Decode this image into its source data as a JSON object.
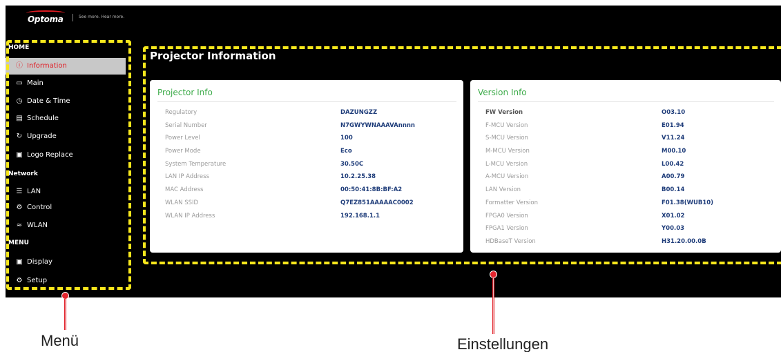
{
  "header": {
    "brand": "Optoma",
    "tagline": "See more. Hear more."
  },
  "sidebar": {
    "sections": [
      {
        "title": "HOME",
        "items": [
          {
            "icon": "info-circle-icon",
            "label": "Information",
            "active": true
          },
          {
            "icon": "monitor-icon",
            "label": "Main"
          },
          {
            "icon": "clock-icon",
            "label": "Date & Time"
          },
          {
            "icon": "calendar-icon",
            "label": "Schedule"
          },
          {
            "icon": "refresh-icon",
            "label": "Upgrade"
          },
          {
            "icon": "image-icon",
            "label": "Logo Replace"
          }
        ]
      },
      {
        "title": "Network",
        "items": [
          {
            "icon": "sitemap-icon",
            "label": "LAN"
          },
          {
            "icon": "cogs-icon",
            "label": "Control"
          },
          {
            "icon": "wifi-icon",
            "label": "WLAN"
          }
        ]
      },
      {
        "title": "MENU",
        "items": [
          {
            "icon": "image-icon",
            "label": "Display"
          },
          {
            "icon": "cogs-icon",
            "label": "Setup"
          }
        ]
      }
    ]
  },
  "main": {
    "title": "Projector Information",
    "projector_info": {
      "title": "Projector Info",
      "rows": [
        {
          "label": "Regulatory",
          "value": "DAZUNGZZ"
        },
        {
          "label": "Serial Number",
          "value": "N7GWYWNAAAVAnnnn"
        },
        {
          "label": "Power Level",
          "value": "100"
        },
        {
          "label": "Power Mode",
          "value": "Eco"
        },
        {
          "label": "System Temperature",
          "value": "30.50C"
        },
        {
          "label": "LAN IP Address",
          "value": "10.2.25.38"
        },
        {
          "label": "MAC Address",
          "value": "00:50:41:8B:BF:A2"
        },
        {
          "label": "WLAN SSID",
          "value": "Q7EZ851AAAAAC0002"
        },
        {
          "label": "WLAN IP Address",
          "value": "192.168.1.1"
        }
      ]
    },
    "version_info": {
      "title": "Version Info",
      "rows": [
        {
          "label": "FW Version",
          "value": "O03.10"
        },
        {
          "label": "F-MCU Version",
          "value": "E01.94"
        },
        {
          "label": "S-MCU Version",
          "value": "V11.24"
        },
        {
          "label": "M-MCU Version",
          "value": "M00.10"
        },
        {
          "label": "L-MCU Version",
          "value": "L00.42"
        },
        {
          "label": "A-MCU Version",
          "value": "A00.79"
        },
        {
          "label": "LAN Version",
          "value": "B00.14"
        },
        {
          "label": "Formatter Version",
          "value": "F01.38(WUB10)"
        },
        {
          "label": "FPGA0 Version",
          "value": "X01.02"
        },
        {
          "label": "FPGA1 Version",
          "value": "Y00.03"
        },
        {
          "label": "HDBaseT Version",
          "value": "H31.20.00.0B"
        }
      ]
    }
  },
  "annotations": {
    "menu_label": "Menü",
    "settings_label": "Einstellungen",
    "highlight_color": "#f7e71c",
    "marker_color": "#e3262f"
  }
}
